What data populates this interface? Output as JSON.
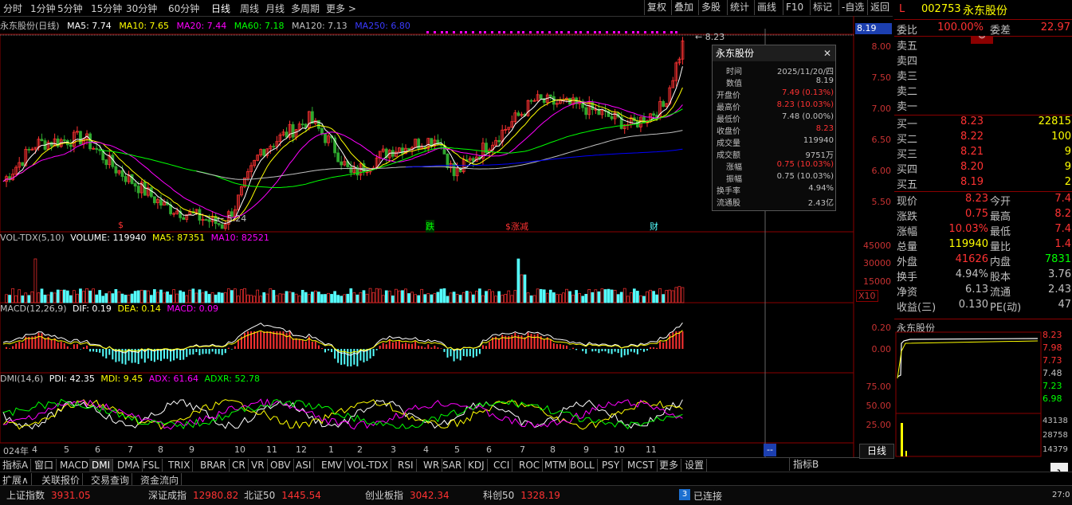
{
  "toolbar": {
    "periods": [
      "分时",
      "1分钟",
      "5分钟",
      "15分钟",
      "30分钟",
      "60分钟",
      "日线",
      "周线",
      "月线",
      "多周期",
      "更多 >"
    ],
    "active_period": "日线",
    "buttons": [
      "复权",
      "叠加",
      "多股",
      "统计",
      "画线",
      "F10",
      "标记",
      "-自选",
      "返回"
    ]
  },
  "ma_line": {
    "title": "永东股份(日线)",
    "ma5": "MA5: 7.74",
    "ma10": "MA10: 7.65",
    "ma20": "MA20: 7.44",
    "ma60": "MA60: 7.18",
    "ma120": "MA120: 7.13",
    "ma250": "MA250: 6.80"
  },
  "colors": {
    "ma5": "#ffffff",
    "ma10": "#ffff00",
    "ma20": "#ff00ff",
    "ma60": "#00ff00",
    "ma120": "#c0c0c0",
    "ma250": "#0000ff",
    "up": "#ff3232",
    "down": "#54ffff",
    "axis": "#c83232",
    "border": "#8b0000"
  },
  "price_axis": [
    "8.00",
    "7.50",
    "7.00",
    "6.50",
    "6.00",
    "5.50"
  ],
  "price_current": "8.19",
  "annotations": {
    "high": "8.23",
    "low": "5.24"
  },
  "markers": [
    "$",
    "跌",
    "$涨减",
    "财"
  ],
  "volume": {
    "title": "VOL-TDX(5,10)",
    "volume": "VOLUME: 119940",
    "ma5": "MA5: 87351",
    "ma10": "MA10: 82521",
    "axis": [
      "45000",
      "30000",
      "15000"
    ],
    "unit": "X10"
  },
  "macd": {
    "title": "MACD(12,26,9)",
    "dif": "DIF: 0.19",
    "dea": "DEA: 0.14",
    "macd": "MACD: 0.09",
    "axis": [
      "0.20",
      "0.00"
    ]
  },
  "dmi": {
    "title": "DMI(14,6)",
    "pdi": "PDI: 42.35",
    "mdi": "MDI: 9.45",
    "adx": "ADX: 61.64",
    "adxr": "ADXR: 52.78",
    "axis": [
      "75.00",
      "50.00",
      "25.00"
    ]
  },
  "months": [
    "024年",
    "4",
    "5",
    "6",
    "7",
    "8",
    "9",
    "10",
    "11",
    "12",
    "1",
    "2",
    "3",
    "4",
    "5",
    "6",
    "7",
    "8",
    "9",
    "10",
    "11"
  ],
  "popup": {
    "title": "永东股份",
    "rows": [
      {
        "label": "时间",
        "value": "2025/11/20/四"
      },
      {
        "label": "数值",
        "value": "8.19"
      },
      {
        "label": "开盘价",
        "value": "7.49 (0.13%)"
      },
      {
        "label": "最高价",
        "value": "8.23 (10.03%)"
      },
      {
        "label": "最低价",
        "value": "7.48 (0.00%)"
      },
      {
        "label": "收盘价",
        "value": "8.23"
      },
      {
        "label": "成交量",
        "value": "119940"
      },
      {
        "label": "成交额",
        "value": "9751万"
      },
      {
        "label": "涨幅",
        "value": "0.75 (10.03%)"
      },
      {
        "label": "振幅",
        "value": "0.75 (10.03%)"
      },
      {
        "label": "换手率",
        "value": "4.94%"
      },
      {
        "label": "流通股",
        "value": "2.43亿"
      }
    ]
  },
  "quote": {
    "flag": "L",
    "code": "002753",
    "name": "永东股份",
    "webi_label": "委比",
    "webi_value": "100.00%",
    "wecha_label": "委差",
    "wecha_value": "22.97",
    "sell": [
      "卖五",
      "卖四",
      "卖三",
      "卖二",
      "卖一"
    ],
    "buy": [
      {
        "label": "买一",
        "price": "8.23",
        "vol": "22815"
      },
      {
        "label": "买二",
        "price": "8.22",
        "vol": "100"
      },
      {
        "label": "买三",
        "price": "8.21",
        "vol": "9"
      },
      {
        "label": "买四",
        "price": "8.20",
        "vol": "9"
      },
      {
        "label": "买五",
        "price": "8.19",
        "vol": "2"
      }
    ],
    "stats": [
      {
        "l1": "现价",
        "v1": "8.23",
        "l2": "今开",
        "v2": "7.4"
      },
      {
        "l1": "涨跌",
        "v1": "0.75",
        "l2": "最高",
        "v2": "8.2"
      },
      {
        "l1": "涨幅",
        "v1": "10.03%",
        "l2": "最低",
        "v2": "7.4"
      },
      {
        "l1": "总量",
        "v1": "119940",
        "l2": "量比",
        "v2": "1.4"
      },
      {
        "l1": "外盘",
        "v1": "41626",
        "l2": "内盘",
        "v2": "7831"
      },
      {
        "l1": "换手",
        "v1": "4.94%",
        "l2": "股本",
        "v2": "3.76"
      },
      {
        "l1": "净资",
        "v1": "6.13",
        "l2": "流通",
        "v2": "2.43"
      },
      {
        "l1": "收益(三)",
        "v1": "0.130",
        "l2": "PE(动)",
        "v2": "47"
      }
    ]
  },
  "mini_chart": {
    "title": "永东股份",
    "axis": [
      "8.23",
      "7.98",
      "7.73",
      "7.48",
      "7.23",
      "6.98"
    ],
    "vol_axis": [
      "43138",
      "28758",
      "14379"
    ]
  },
  "bottom_tabs": [
    "指标A",
    "窗口",
    "MACD",
    "DMI",
    "DMA",
    "FSL",
    "TRIX",
    "BRAR",
    "CR",
    "VR",
    "OBV",
    "ASI",
    "EMV",
    "VOL-TDX",
    "RSI",
    "WR",
    "SAR",
    "KDJ",
    "CCI",
    "ROC",
    "MTM",
    "BOLL",
    "PSY",
    "MCST",
    "更多",
    "设置"
  ],
  "bottom_extra": {
    "indicator_b": "指标B",
    "daily": "日线",
    "dash": "--"
  },
  "sub_tabs": [
    "扩展∧",
    "关联报价",
    "交易查询",
    "资金流向"
  ],
  "status": {
    "items": [
      {
        "name": "上证指数",
        "value": "3931.05"
      },
      {
        "name": "深证成指",
        "value": "12980.82"
      },
      {
        "name": "北证50",
        "value": "1445.54"
      },
      {
        "name": "创业板指",
        "value": "3042.34"
      },
      {
        "name": "科创50",
        "value": "1328.19"
      }
    ],
    "connected_count": "3",
    "connected": "已连接",
    "clock": "27:0"
  }
}
